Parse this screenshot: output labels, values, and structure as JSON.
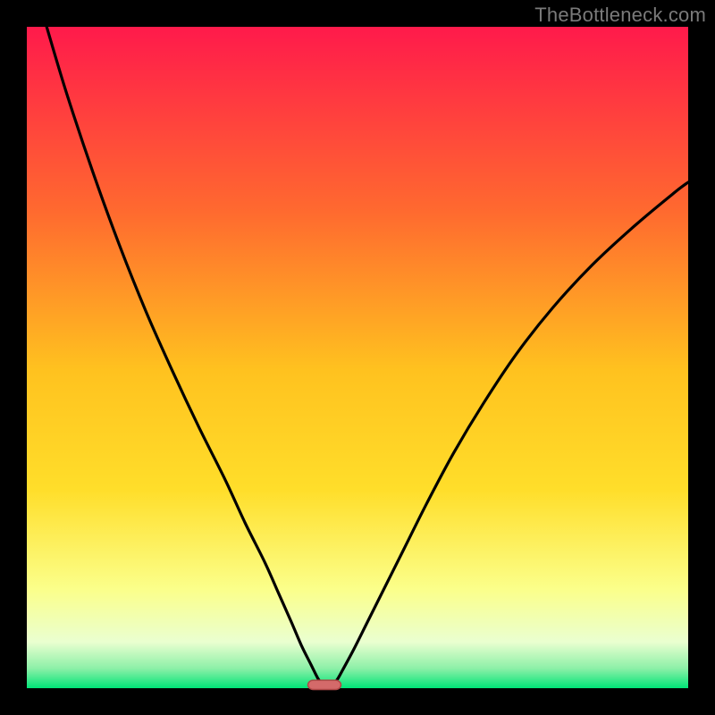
{
  "attribution": "TheBottleneck.com",
  "colors": {
    "frame": "#000000",
    "gradient_top": "#ff1a4b",
    "gradient_mid_upper": "#ff8a2a",
    "gradient_mid": "#ffde2a",
    "gradient_lower": "#ffff66",
    "gradient_pale": "#f7ffd9",
    "gradient_green": "#00e477",
    "curve": "#000000",
    "marker_fill": "#d46a6a",
    "marker_stroke": "#b04747"
  },
  "chart_data": {
    "type": "line",
    "title": "",
    "xlabel": "",
    "ylabel": "",
    "xlim": [
      0,
      100
    ],
    "ylim": [
      0,
      100
    ],
    "notes": "Two monotone curve branches meeting at a cusp near x≈45, y≈0; background vertical gradient red→yellow→green; small rounded marker at the cusp on the baseline.",
    "cusp": {
      "x": 45,
      "y": 0
    },
    "marker": {
      "x": 45,
      "y": 0.5,
      "width": 5,
      "height": 1.4
    },
    "series": [
      {
        "name": "left-branch",
        "x": [
          3,
          6,
          10,
          14,
          18,
          22,
          26,
          30,
          33,
          36,
          38,
          40,
          41.5,
          43,
          44,
          44.8
        ],
        "values": [
          100,
          90,
          78,
          67,
          57,
          48,
          39.5,
          31.5,
          25,
          19,
          14.5,
          10,
          6.5,
          3.5,
          1.5,
          0.4
        ]
      },
      {
        "name": "right-branch",
        "x": [
          46.2,
          47,
          48,
          49.5,
          51.5,
          54,
          57,
          60.5,
          64.5,
          69,
          74,
          79.5,
          85.5,
          92,
          98,
          100
        ],
        "values": [
          0.4,
          1.4,
          3.2,
          6,
          10,
          15,
          21,
          28,
          35.5,
          43,
          50.5,
          57.5,
          64,
          70,
          75,
          76.5
        ]
      }
    ]
  }
}
